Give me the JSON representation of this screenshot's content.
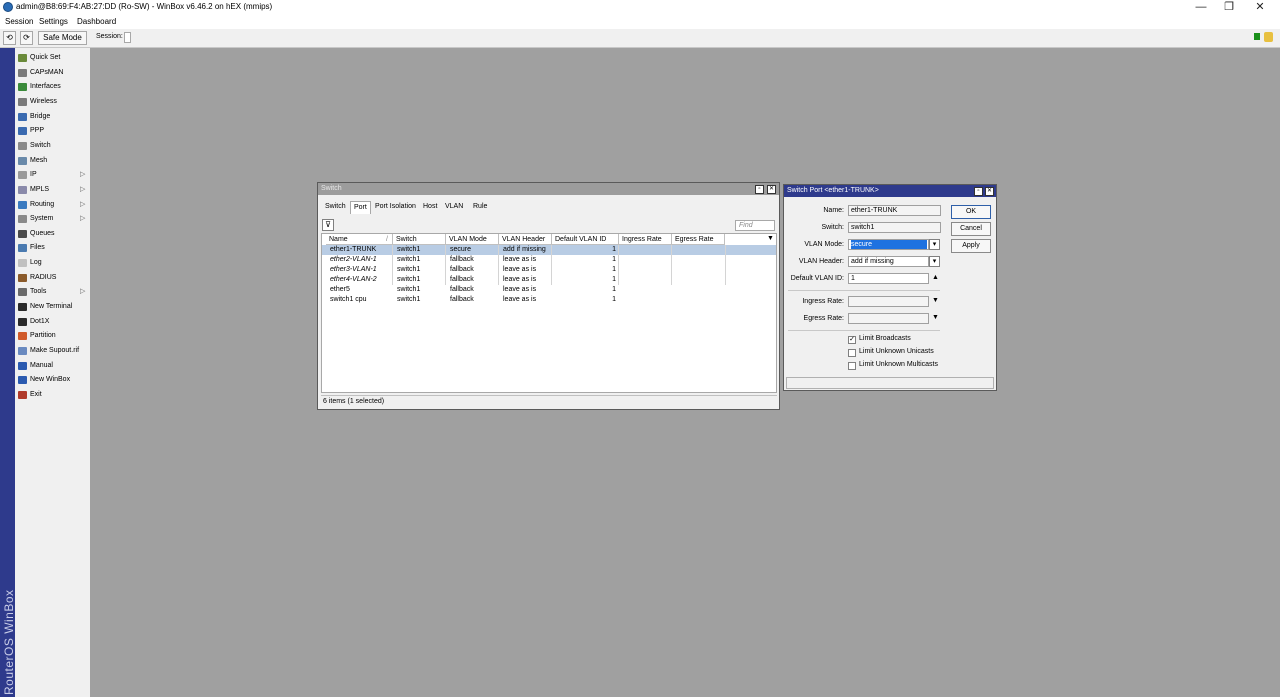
{
  "window": {
    "title": "admin@B8:69:F4:AB:27:DD (Ro-SW) - WinBox v6.46.2 on hEX (mmips)",
    "minimize": "—",
    "maximize": "❐",
    "close": "✕"
  },
  "menu": [
    "Session",
    "Settings",
    "Dashboard"
  ],
  "toolbar": {
    "undo": "⟲",
    "redo": "⟳",
    "safe_mode": "Safe Mode",
    "session_label": "Session:"
  },
  "brand": "RouterOS WinBox",
  "sidebar": {
    "items": [
      {
        "label": "Quick Set",
        "icon": "quick-set-icon",
        "color": "#6a8a3a",
        "arrow": ""
      },
      {
        "label": "CAPsMAN",
        "icon": "capsman-icon",
        "color": "#7a7a7a",
        "arrow": ""
      },
      {
        "label": "Interfaces",
        "icon": "interfaces-icon",
        "color": "#3a8a3a",
        "arrow": ""
      },
      {
        "label": "Wireless",
        "icon": "wireless-icon",
        "color": "#7a7a7a",
        "arrow": ""
      },
      {
        "label": "Bridge",
        "icon": "bridge-icon",
        "color": "#3a6ab0",
        "arrow": ""
      },
      {
        "label": "PPP",
        "icon": "ppp-icon",
        "color": "#3a6ab0",
        "arrow": ""
      },
      {
        "label": "Switch",
        "icon": "switch-icon",
        "color": "#8a8a8a",
        "arrow": ""
      },
      {
        "label": "Mesh",
        "icon": "mesh-icon",
        "color": "#6a8aaa",
        "arrow": ""
      },
      {
        "label": "IP",
        "icon": "ip-icon",
        "color": "#9a9a9a",
        "arrow": "▷"
      },
      {
        "label": "MPLS",
        "icon": "mpls-icon",
        "color": "#8a8aaa",
        "arrow": "▷"
      },
      {
        "label": "Routing",
        "icon": "routing-icon",
        "color": "#3a7ac0",
        "arrow": "▷"
      },
      {
        "label": "System",
        "icon": "system-icon",
        "color": "#8a8a8a",
        "arrow": "▷"
      },
      {
        "label": "Queues",
        "icon": "queues-icon",
        "color": "#4a4a4a",
        "arrow": ""
      },
      {
        "label": "Files",
        "icon": "files-icon",
        "color": "#4a7ab0",
        "arrow": ""
      },
      {
        "label": "Log",
        "icon": "log-icon",
        "color": "#c0c0c0",
        "arrow": ""
      },
      {
        "label": "RADIUS",
        "icon": "radius-icon",
        "color": "#8a5a2a",
        "arrow": ""
      },
      {
        "label": "Tools",
        "icon": "tools-icon",
        "color": "#6a6a6a",
        "arrow": "▷"
      },
      {
        "label": "New Terminal",
        "icon": "terminal-icon",
        "color": "#2a2a2a",
        "arrow": ""
      },
      {
        "label": "Dot1X",
        "icon": "dot1x-icon",
        "color": "#2a2a2a",
        "arrow": ""
      },
      {
        "label": "Partition",
        "icon": "partition-icon",
        "color": "#d05a2a",
        "arrow": ""
      },
      {
        "label": "Make Supout.rif",
        "icon": "supout-icon",
        "color": "#6a8ac0",
        "arrow": ""
      },
      {
        "label": "Manual",
        "icon": "manual-icon",
        "color": "#2a5ab0",
        "arrow": ""
      },
      {
        "label": "New WinBox",
        "icon": "winbox-icon",
        "color": "#2a5ab0",
        "arrow": ""
      },
      {
        "label": "Exit",
        "icon": "exit-icon",
        "color": "#b03a2a",
        "arrow": ""
      }
    ]
  },
  "switch_window": {
    "title": "Switch",
    "tabs": [
      "Switch",
      "Port",
      "Port Isolation",
      "Host",
      "VLAN",
      "Rule"
    ],
    "active_tab": "Port",
    "find_placeholder": "Find",
    "columns": [
      "Name",
      "Switch",
      "VLAN Mode",
      "VLAN Header",
      "Default VLAN ID",
      "Ingress Rate",
      "Egress Rate"
    ],
    "sort_marker": "/",
    "rows": [
      {
        "name": "ether1-TRUNK",
        "switch": "switch1",
        "vlan_mode": "secure",
        "vlan_header": "add if missing",
        "default_vlan_id": "1",
        "ingress": "",
        "egress": "",
        "italic": false,
        "selected": true
      },
      {
        "name": "ether2-VLAN-1",
        "switch": "switch1",
        "vlan_mode": "fallback",
        "vlan_header": "leave as is",
        "default_vlan_id": "1",
        "ingress": "",
        "egress": "",
        "italic": true,
        "selected": false
      },
      {
        "name": "ether3-VLAN-1",
        "switch": "switch1",
        "vlan_mode": "fallback",
        "vlan_header": "leave as is",
        "default_vlan_id": "1",
        "ingress": "",
        "egress": "",
        "italic": true,
        "selected": false
      },
      {
        "name": "ether4-VLAN-2",
        "switch": "switch1",
        "vlan_mode": "fallback",
        "vlan_header": "leave as is",
        "default_vlan_id": "1",
        "ingress": "",
        "egress": "",
        "italic": true,
        "selected": false
      },
      {
        "name": "ether5",
        "switch": "switch1",
        "vlan_mode": "fallback",
        "vlan_header": "leave as is",
        "default_vlan_id": "1",
        "ingress": "",
        "egress": "",
        "italic": false,
        "selected": false
      },
      {
        "name": "switch1 cpu",
        "switch": "switch1",
        "vlan_mode": "fallback",
        "vlan_header": "leave as is",
        "default_vlan_id": "1",
        "ingress": "",
        "egress": "",
        "italic": false,
        "selected": false
      }
    ],
    "status": "6 items (1 selected)"
  },
  "port_window": {
    "title": "Switch Port <ether1-TRUNK>",
    "fields": {
      "name_label": "Name:",
      "name_value": "ether1-TRUNK",
      "switch_label": "Switch:",
      "switch_value": "switch1",
      "vlan_mode_label": "VLAN Mode:",
      "vlan_mode_value": "secure",
      "vlan_header_label": "VLAN Header:",
      "vlan_header_value": "add if missing",
      "default_vlan_label": "Default VLAN ID:",
      "default_vlan_value": "1",
      "ingress_label": "Ingress Rate:",
      "ingress_value": "",
      "egress_label": "Egress Rate:",
      "egress_value": ""
    },
    "checkboxes": [
      {
        "label": "Limit Broadcasts",
        "checked": true
      },
      {
        "label": "Limit Unknown Unicasts",
        "checked": false
      },
      {
        "label": "Limit Unknown Multicasts",
        "checked": false
      }
    ],
    "buttons": {
      "ok": "OK",
      "cancel": "Cancel",
      "apply": "Apply"
    }
  }
}
